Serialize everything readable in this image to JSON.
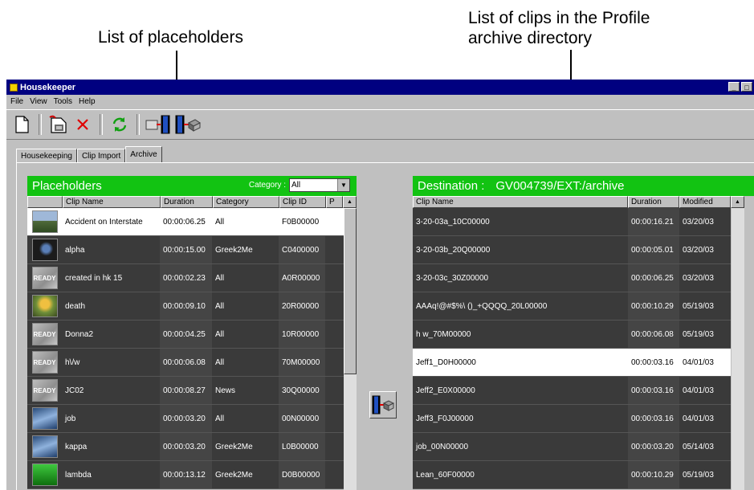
{
  "callouts": {
    "placeholders": "List of placeholders",
    "profile_line1": "List of clips in the Profile",
    "profile_line2": "archive directory"
  },
  "window": {
    "title": "Housekeeper",
    "min_label": "_",
    "max_label": "□",
    "menu": {
      "file": "File",
      "file_rest": "ile",
      "view": "View",
      "tools": "Tools",
      "help": "Help"
    }
  },
  "tabs": [
    "Housekeeping",
    "Clip Import",
    "Archive"
  ],
  "placeholders": {
    "title": "Placeholders",
    "category_label": "Category :",
    "category_value": "All",
    "columns": [
      "Clip Name",
      "Duration",
      "Category",
      "Clip ID",
      "P"
    ],
    "rows": [
      {
        "thumb": "landscape",
        "name": "Accident on Interstate",
        "duration": "00:00:06.25",
        "category": "All",
        "clip_id": "F0B00000",
        "selected": true
      },
      {
        "thumb": "dark",
        "name": "alpha",
        "duration": "00:00:15.00",
        "category": "Greek2Me",
        "clip_id": "C0400000"
      },
      {
        "thumb": "ready",
        "name": "created in hk 15",
        "duration": "00:00:02.23",
        "category": "All",
        "clip_id": "A0R00000"
      },
      {
        "thumb": "flower",
        "name": "death",
        "duration": "00:00:09.10",
        "category": "All",
        "clip_id": "20R00000"
      },
      {
        "thumb": "ready",
        "name": "Donna2",
        "duration": "00:00:04.25",
        "category": "All",
        "clip_id": "10R00000"
      },
      {
        "thumb": "ready",
        "name": "h\\/w",
        "duration": "00:00:06.08",
        "category": "All",
        "clip_id": "70M00000"
      },
      {
        "thumb": "ready",
        "name": "JC02",
        "duration": "00:00:08.27",
        "category": "News",
        "clip_id": "30Q00000"
      },
      {
        "thumb": "water",
        "name": "job",
        "duration": "00:00:03.20",
        "category": "All",
        "clip_id": "00N00000"
      },
      {
        "thumb": "water",
        "name": "kappa",
        "duration": "00:00:03.20",
        "category": "Greek2Me",
        "clip_id": "L0B00000"
      },
      {
        "thumb": "green",
        "name": "lambda",
        "duration": "00:00:13.12",
        "category": "Greek2Me",
        "clip_id": "D0B00000"
      }
    ],
    "ready_text": "READY"
  },
  "destination": {
    "label": "Destination :",
    "path": "GV004739/EXT:/archive",
    "columns": [
      "Clip Name",
      "Duration",
      "Modified"
    ],
    "rows": [
      {
        "name": "3-20-03a_10C00000",
        "duration": "00:00:16.21",
        "modified": "03/20/03"
      },
      {
        "name": "3-20-03b_20Q00000",
        "duration": "00:00:05.01",
        "modified": "03/20/03"
      },
      {
        "name": "3-20-03c_30Z00000",
        "duration": "00:00:06.25",
        "modified": "03/20/03"
      },
      {
        "name": "AAAq!@#$%\\ ()_+QQQQ_20L00000",
        "duration": "00:00:10.29",
        "modified": "05/19/03"
      },
      {
        "name": "h w_70M00000",
        "duration": "00:00:06.08",
        "modified": "05/19/03"
      },
      {
        "name": "Jeff1_D0H00000",
        "duration": "00:00:03.16",
        "modified": "04/01/03",
        "selected": true
      },
      {
        "name": "Jeff2_E0X00000",
        "duration": "00:00:03.16",
        "modified": "04/01/03"
      },
      {
        "name": "Jeff3_F0J00000",
        "duration": "00:00:03.16",
        "modified": "04/01/03"
      },
      {
        "name": "job_00N00000",
        "duration": "00:00:03.20",
        "modified": "05/14/03"
      },
      {
        "name": "Lean_60F00000",
        "duration": "00:00:10.29",
        "modified": "05/19/03"
      }
    ]
  },
  "colors": {
    "header_green": "#12c312",
    "titlebar_blue": "#000080",
    "row_dark": "#3a3a3a",
    "row_selected": "#ffffff"
  },
  "icons": [
    "new-icon",
    "open-icon",
    "delete-icon",
    "refresh-icon",
    "import-clip-icon",
    "archive-transfer-icon"
  ]
}
